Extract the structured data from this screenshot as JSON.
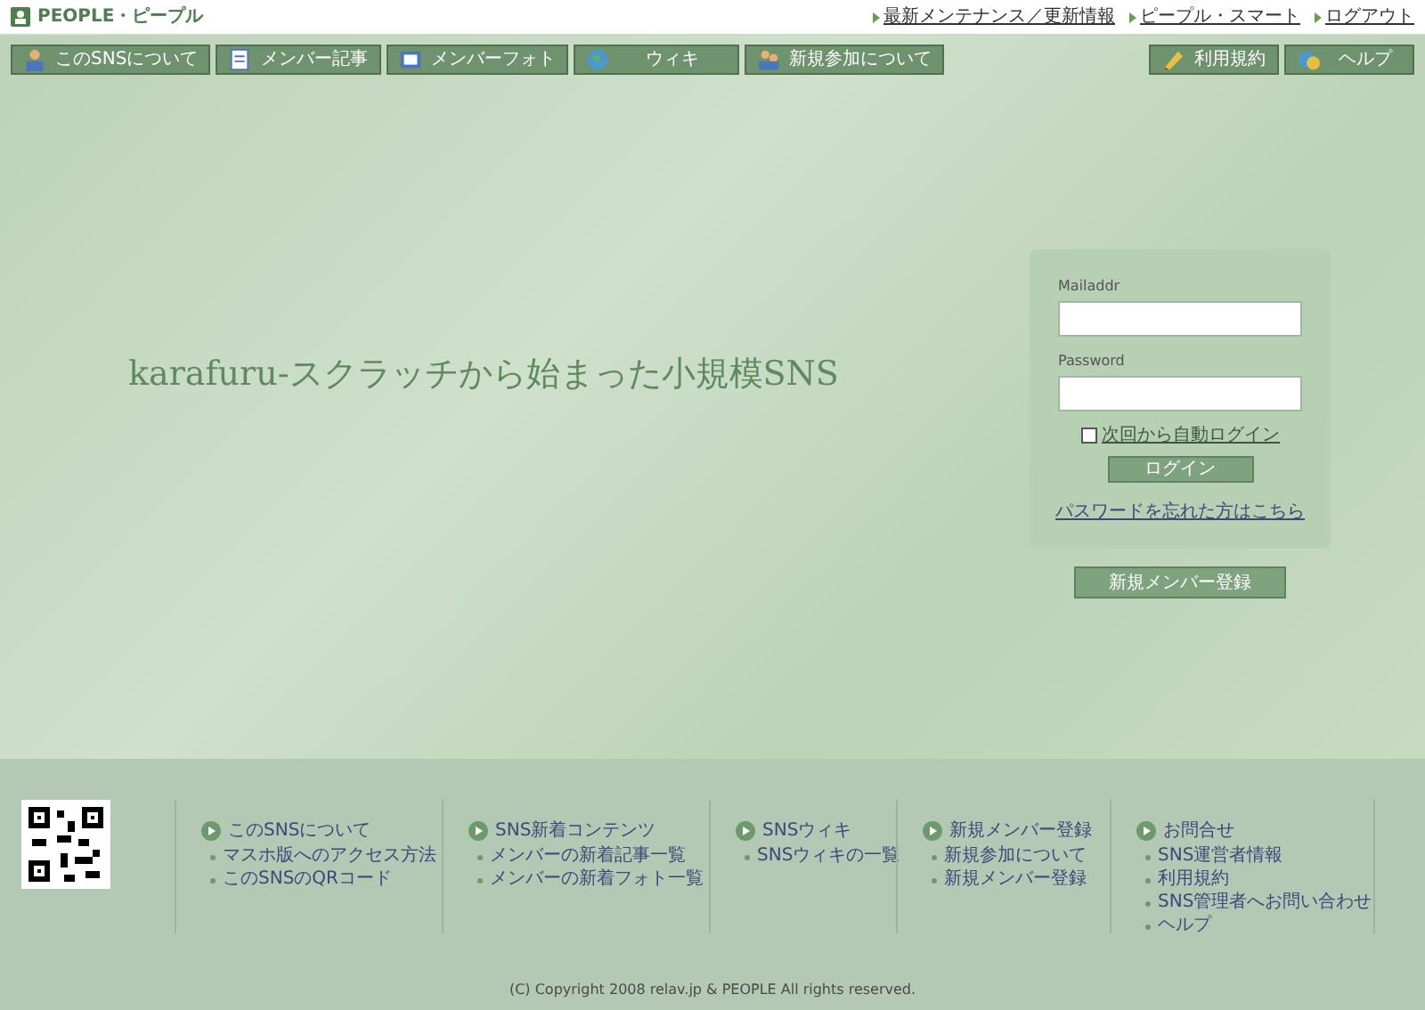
{
  "header": {
    "logo": "PEOPLE・ピープル",
    "links": [
      "最新メンテナンス／更新情報",
      "ピープル・スマート",
      "ログアウト"
    ]
  },
  "nav": {
    "left": [
      {
        "label": "このSNSについて"
      },
      {
        "label": "メンバー記事"
      },
      {
        "label": "メンバーフォト"
      },
      {
        "label": "ウィキ"
      },
      {
        "label": "新規参加について"
      }
    ],
    "right": [
      {
        "label": "利用規約"
      },
      {
        "label": "ヘルプ"
      }
    ]
  },
  "hero": {
    "title": "karafuru-スクラッチから始まった小規模SNS"
  },
  "login": {
    "mail_label": "Mailaddr",
    "password_label": "Password",
    "auto_login": {
      "label": "次回から自動ログイン",
      "checked": false
    },
    "submit": "ログイン",
    "forgot": "パスワードを忘れた方はこちら",
    "register": "新規メンバー登録"
  },
  "footer": {
    "columns": [
      {
        "title": "このSNSについて",
        "links": [
          "マスホ版へのアクセス方法",
          "このSNSのQRコード"
        ]
      },
      {
        "title": "SNS新着コンテンツ",
        "links": [
          "メンバーの新着記事一覧",
          "メンバーの新着フォト一覧"
        ]
      },
      {
        "title": "SNSウィキ",
        "links": [
          "SNSウィキの一覧"
        ]
      },
      {
        "title": "新規メンバー登録",
        "links": [
          "新規参加について",
          "新規メンバー登録"
        ]
      },
      {
        "title": "お問合せ",
        "links": [
          "SNS運営者情報",
          "利用規約",
          "SNS管理者へお問い合わせ",
          "ヘルプ"
        ]
      }
    ],
    "copyright": "(C) Copyright 2008 relav.jp & PEOPLE All rights reserved."
  }
}
